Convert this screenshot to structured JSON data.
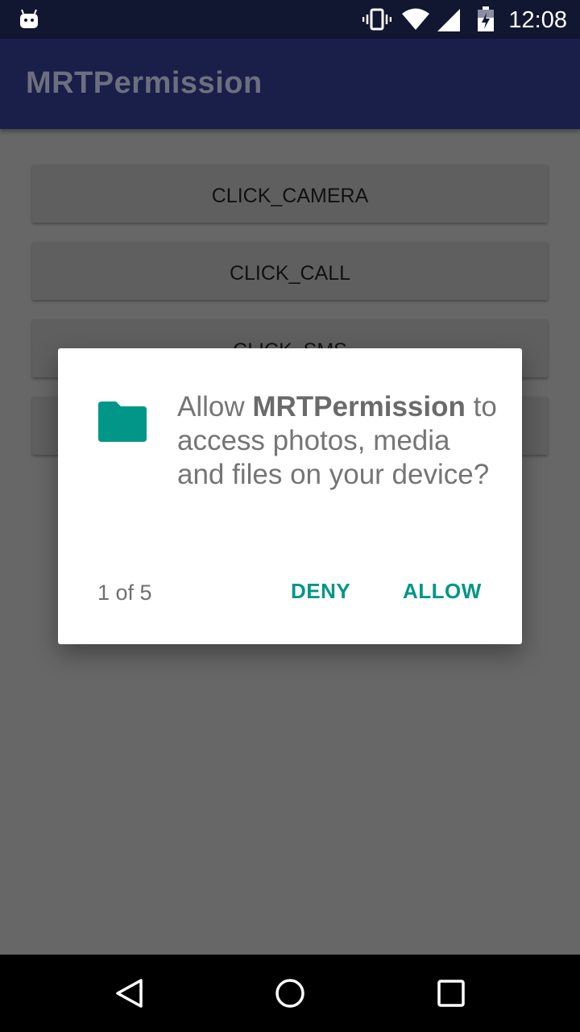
{
  "status_bar": {
    "time": "12:08",
    "icons": [
      "android-debug-icon",
      "vibrate-icon",
      "wifi-icon",
      "signal-icon",
      "battery-icon"
    ]
  },
  "app_bar": {
    "title": "MRTPermission"
  },
  "buttons": [
    {
      "label": "CLICK_CAMERA"
    },
    {
      "label": "CLICK_CALL"
    },
    {
      "label": "CLICK_SMS"
    },
    {
      "label": ""
    }
  ],
  "dialog": {
    "icon": "folder-icon",
    "message_prefix": "Allow ",
    "app_name": "MRTPermission",
    "message_suffix": " to access photos, media and files on your device?",
    "page_counter": "1 of 5",
    "deny_label": "DENY",
    "allow_label": "ALLOW"
  },
  "nav_bar": {
    "icons": [
      "back-icon",
      "home-icon",
      "recents-icon"
    ]
  },
  "colors": {
    "status_bar_bg": "#111631",
    "app_bar_bg": "#1a1f49",
    "scrim_bg": "#676767",
    "accent": "#009688"
  }
}
